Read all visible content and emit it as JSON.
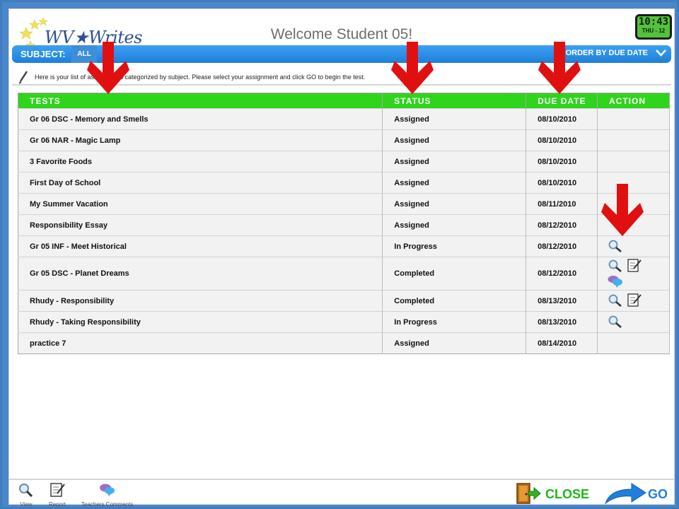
{
  "app": {
    "logo_text": "WV★Writes"
  },
  "header": {
    "welcome": "Welcome Student 05!"
  },
  "clock": {
    "time": "10:43",
    "date": "THU - 12"
  },
  "subject_bar": {
    "label": "SUBJECT:",
    "value": "ALL",
    "order_label": "ORDER BY DUE DATE"
  },
  "instructions": "Here is your list of assignments categorized by subject. Please select your assignment and click GO to begin the test.",
  "table": {
    "headers": [
      "TESTS",
      "STATUS",
      "DUE DATE",
      "ACTION"
    ],
    "rows": [
      {
        "test": "Gr 06 DSC - Memory and Smells",
        "status": "Assigned",
        "due": "08/10/2010",
        "actions": []
      },
      {
        "test": "Gr 06 NAR - Magic Lamp",
        "status": "Assigned",
        "due": "08/10/2010",
        "actions": []
      },
      {
        "test": "3 Favorite Foods",
        "status": "Assigned",
        "due": "08/10/2010",
        "actions": []
      },
      {
        "test": "First Day of School",
        "status": "Assigned",
        "due": "08/10/2010",
        "actions": []
      },
      {
        "test": "My Summer Vacation",
        "status": "Assigned",
        "due": "08/11/2010",
        "actions": []
      },
      {
        "test": "Responsibility Essay",
        "status": "Assigned",
        "due": "08/12/2010",
        "actions": []
      },
      {
        "test": "Gr 05 INF - Meet Historical",
        "status": "In Progress",
        "due": "08/12/2010",
        "actions": [
          "view"
        ]
      },
      {
        "test": "Gr 05 DSC - Planet Dreams",
        "status": "Completed",
        "due": "08/12/2010",
        "actions": [
          "view",
          "report",
          "comments"
        ]
      },
      {
        "test": "Rhudy - Responsibility",
        "status": "Completed",
        "due": "08/13/2010",
        "actions": [
          "view",
          "report"
        ]
      },
      {
        "test": "Rhudy - Taking Responsibility",
        "status": "In Progress",
        "due": "08/13/2010",
        "actions": [
          "view"
        ]
      },
      {
        "test": "practice 7",
        "status": "Assigned",
        "due": "08/14/2010",
        "actions": []
      }
    ]
  },
  "footer": {
    "legend": [
      {
        "icon": "magnifier-icon",
        "label": "View"
      },
      {
        "icon": "report-icon",
        "label": "Report"
      },
      {
        "icon": "comments-icon",
        "label": "Teachers Comments"
      }
    ],
    "close_label": "CLOSE",
    "go_label": "GO"
  },
  "colors": {
    "header_green": "#2fd41c",
    "subject_blue": "#1d7fd8",
    "annotation_red": "#e01010",
    "close_green": "#20b718",
    "go_blue": "#1f80dc"
  }
}
